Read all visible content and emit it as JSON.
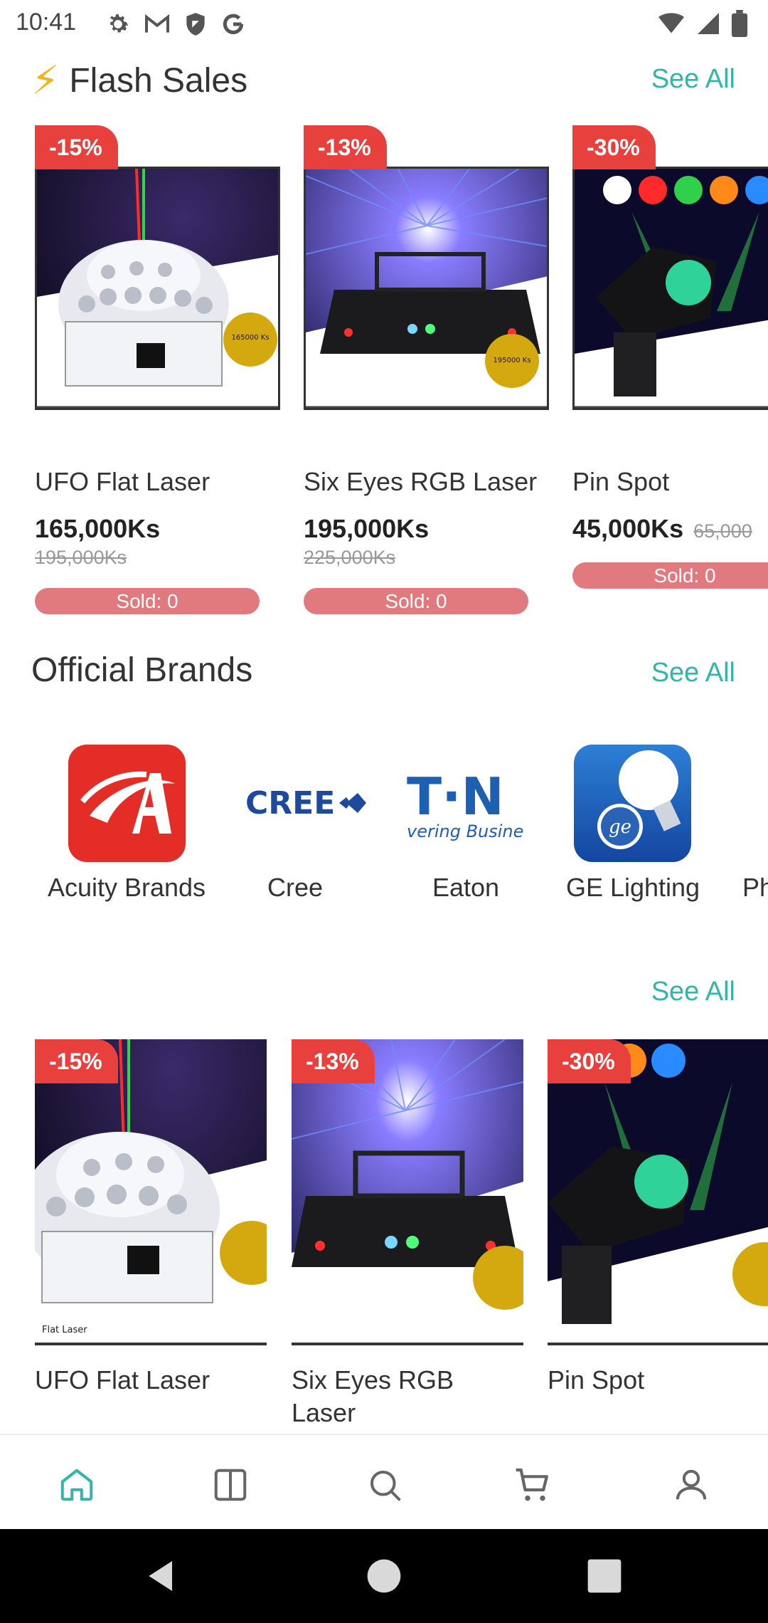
{
  "status_bar": {
    "time": "10:41",
    "left_icons": [
      "gear-icon",
      "gmail-icon",
      "shield-icon",
      "google-icon"
    ],
    "right_icons": [
      "wifi-icon",
      "signal-icon",
      "battery-icon"
    ]
  },
  "flash_sales": {
    "title": "Flash Sales",
    "icon": "lightning-icon",
    "see_all": "See All",
    "items": [
      {
        "discount": "-15%",
        "name": "UFO Flat Laser",
        "price": "165,000Ks",
        "old_price": "195,000Ks",
        "sold": "Sold: 0"
      },
      {
        "discount": "-13%",
        "name": "Six Eyes RGB Laser",
        "price": "195,000Ks",
        "old_price": "225,000Ks",
        "sold": "Sold: 0"
      },
      {
        "discount": "-30%",
        "name": "Pin Spot",
        "price": "45,000Ks",
        "old_price": "65,000",
        "sold": "Sold: 0"
      }
    ]
  },
  "brands": {
    "title": "Official Brands",
    "see_all": "See All",
    "items": [
      {
        "name": "Acuity Brands"
      },
      {
        "name": "Cree",
        "logo_text": "CREE"
      },
      {
        "name": "Eaton",
        "logo_text": "T·N",
        "logo_sub": "vering Business V"
      },
      {
        "name": "GE Lighting"
      },
      {
        "name": "Ph"
      }
    ]
  },
  "products": {
    "see_all": "See All",
    "items": [
      {
        "discount": "-15%",
        "name": "UFO Flat Laser"
      },
      {
        "discount": "-13%",
        "name": "Six Eyes RGB Laser"
      },
      {
        "discount": "-30%",
        "name": "Pin Spot"
      }
    ]
  },
  "bottom_nav": {
    "items": [
      "home-icon",
      "catalog-icon",
      "search-icon",
      "cart-icon",
      "profile-icon"
    ],
    "active": "home-icon",
    "accent_color": "#32b5aa"
  },
  "colors": {
    "accent": "#32b5aa",
    "badge": "#e8403c",
    "sold_pill": "#e07a7e"
  }
}
